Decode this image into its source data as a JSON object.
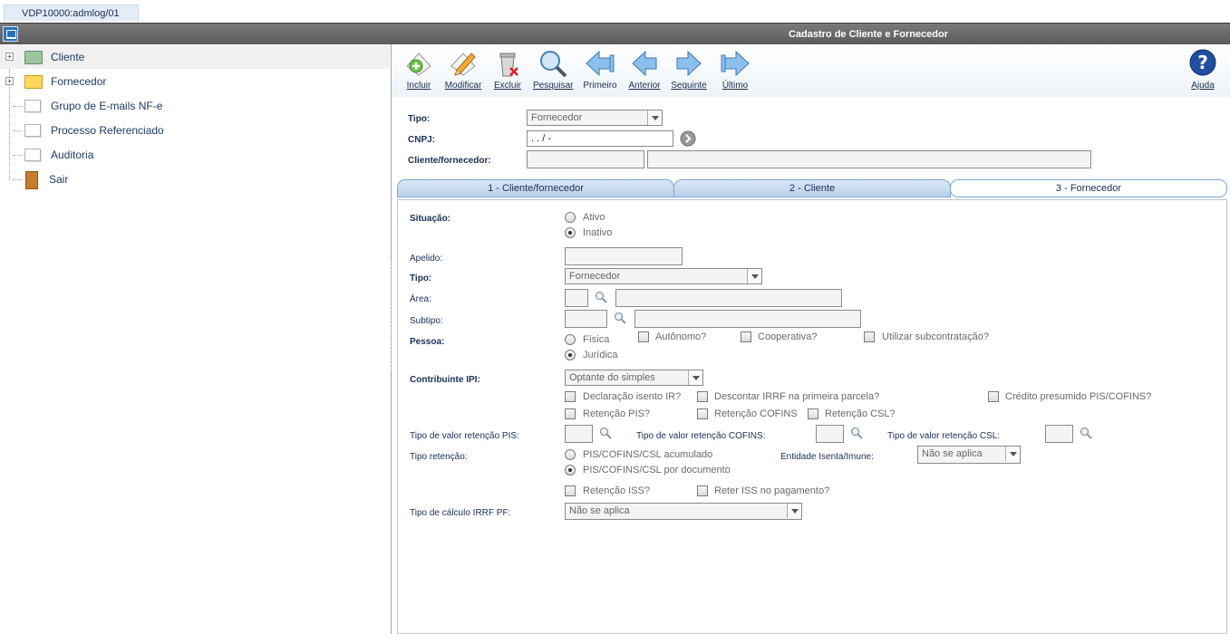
{
  "session_tab": "VDP10000:admlog/01",
  "window_title": "Cadastro de Cliente e Fornecedor",
  "tree": [
    {
      "label": "Cliente",
      "icon": "folder-green-icon",
      "expandable": true,
      "selected": true
    },
    {
      "label": "Fornecedor",
      "icon": "folder-yellow-icon",
      "expandable": true,
      "selected": false
    },
    {
      "label": "Grupo de E-mails NF-e",
      "icon": "page-icon",
      "expandable": false,
      "selected": false
    },
    {
      "label": "Processo Referenciado",
      "icon": "page-icon",
      "expandable": false,
      "selected": false
    },
    {
      "label": "Auditoria",
      "icon": "page-icon",
      "expandable": false,
      "selected": false
    },
    {
      "label": "Sair",
      "icon": "exit-door-icon",
      "expandable": false,
      "selected": false
    }
  ],
  "toolbar": {
    "incluir": "Incluir",
    "modificar": "Modificar",
    "excluir": "Excluir",
    "pesquisar": "Pesquisar",
    "primeiro": "Primeiro",
    "anterior": "Anterior",
    "seguinte": "Seguinte",
    "ultimo": "Último",
    "ajuda": "Ajuda"
  },
  "header_form": {
    "tipo_label": "Tipo:",
    "tipo_value": "Fornecedor",
    "cnpj_label": "CNPJ:",
    "cnpj_value": " .  .  /  -",
    "cliente_label": "Cliente/fornecedor:"
  },
  "tabs": [
    "1 - Cliente/fornecedor",
    "2 - Cliente",
    "3 - Fornecedor"
  ],
  "fornecedor": {
    "situacao_label": "Situação:",
    "ativo": "Ativo",
    "inativo": "Inativo",
    "apelido_label": "Apelido:",
    "tipo_label": "Tipo:",
    "tipo_value": "Fornecedor",
    "area_label": "Área:",
    "subtipo_label": "Subtipo:",
    "pessoa_label": "Pessoa:",
    "fisica": "Física",
    "juridica": "Jurídica",
    "autonomo": "Autônomo?",
    "cooperativa": "Cooperativa?",
    "subcontratacao": "Utilizar subcontratação?",
    "contribuinte_label": "Contribuinte IPI:",
    "contribuinte_value": "Optante do simples",
    "declaracao": "Declaração isento IR?",
    "descontar": "Descontar IRRF na primeira parcela?",
    "credito": "Crédito presumido PIS/COFINS?",
    "retencao_pis": "Retenção PIS?",
    "retencao_cofins": "Retenção COFINS",
    "retencao_csl": "Retenção CSL?",
    "tv_pis_label": "Tipo de valor retenção PIS:",
    "tv_cofins_label": "Tipo de valor retenção COFINS:",
    "tv_csl_label": "Tipo de valor retenção CSL:",
    "tipo_retencao_label": "Tipo retenção:",
    "acumulado": "PIS/COFINS/CSL acumulado",
    "por_documento": "PIS/COFINS/CSL por documento",
    "entidade_label": "Entidade Isenta/Imune:",
    "entidade_value": "Não se aplica",
    "retencao_iss": "Retenção ISS?",
    "reter_iss": "Reter ISS no pagamento?",
    "irrf_label": "Tipo de cálculo IRRF PF:",
    "irrf_value": "Não se aplica"
  }
}
